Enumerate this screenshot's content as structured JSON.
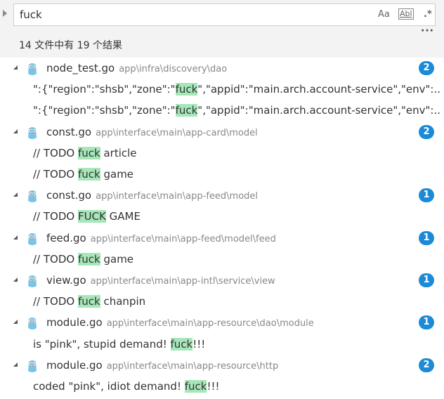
{
  "search": {
    "query": "fuck",
    "match_case_label": "Aa",
    "whole_word_label": "Abl",
    "regex_label": ".*",
    "more_label": "···"
  },
  "summary": "14 文件中有 19 个结果",
  "results": [
    {
      "file": "node_test.go",
      "path": "app\\infra\\discovery\\dao",
      "count": "2",
      "matches": [
        {
          "pre": "\":{\"region\":\"shsb\",\"zone\":\"",
          "hit": "fuck",
          "post": "\",\"appid\":\"main.arch.account-service\",\"env\":.."
        },
        {
          "pre": "\":{\"region\":\"shsb\",\"zone\":\"",
          "hit": "fuck",
          "post": "\",\"appid\":\"main.arch.account-service\",\"env\":.."
        }
      ]
    },
    {
      "file": "const.go",
      "path": "app\\interface\\main\\app-card\\model",
      "count": "2",
      "matches": [
        {
          "pre": "// TODO ",
          "hit": "fuck",
          "post": " article"
        },
        {
          "pre": "// TODO ",
          "hit": "fuck",
          "post": " game"
        }
      ]
    },
    {
      "file": "const.go",
      "path": "app\\interface\\main\\app-feed\\model",
      "count": "1",
      "matches": [
        {
          "pre": "// TODO ",
          "hit": "FUCK",
          "post": " GAME"
        }
      ]
    },
    {
      "file": "feed.go",
      "path": "app\\interface\\main\\app-feed\\model\\feed",
      "count": "1",
      "matches": [
        {
          "pre": "// TODO ",
          "hit": "fuck",
          "post": " game"
        }
      ]
    },
    {
      "file": "view.go",
      "path": "app\\interface\\main\\app-intl\\service\\view",
      "count": "1",
      "matches": [
        {
          "pre": "// TODO ",
          "hit": "fuck",
          "post": " chanpin"
        }
      ]
    },
    {
      "file": "module.go",
      "path": "app\\interface\\main\\app-resource\\dao\\module",
      "count": "1",
      "matches": [
        {
          "pre": "is \"pink\", stupid demand! ",
          "hit": "fuck",
          "post": "!!!"
        }
      ]
    },
    {
      "file": "module.go",
      "path": "app\\interface\\main\\app-resource\\http",
      "count": "2",
      "matches": [
        {
          "pre": "coded \"pink\", idiot demand! ",
          "hit": "fuck",
          "post": "!!!"
        }
      ]
    }
  ],
  "colors": {
    "badge": "#1c8ad6",
    "highlight": "#a6e6b8"
  }
}
